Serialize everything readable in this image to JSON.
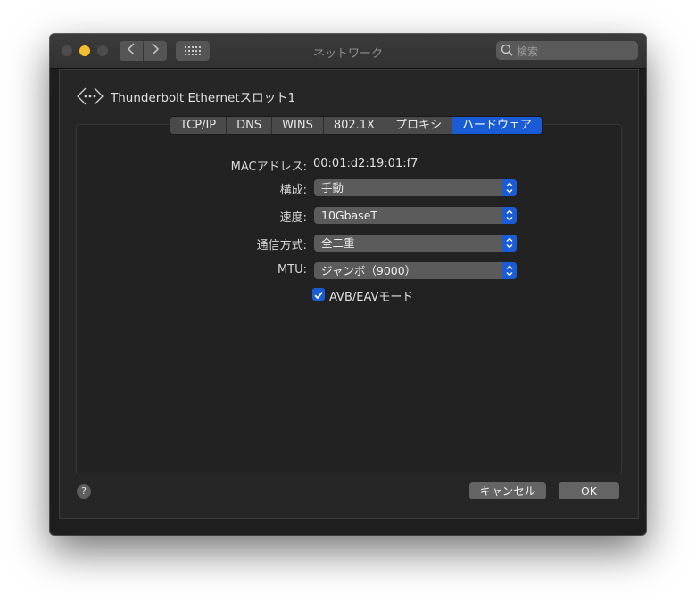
{
  "window": {
    "title": "ネットワーク"
  },
  "search": {
    "placeholder": "検索"
  },
  "interface": {
    "name": "Thunderbolt Ethernetスロット1"
  },
  "tabs": [
    {
      "label": "TCP/IP"
    },
    {
      "label": "DNS"
    },
    {
      "label": "WINS"
    },
    {
      "label": "802.1X"
    },
    {
      "label": "プロキシ"
    },
    {
      "label": "ハードウェア",
      "active": true
    }
  ],
  "hardware": {
    "mac_label": "MACアドレス:",
    "mac_value": "00:01:d2:19:01:f7",
    "config_label": "構成:",
    "config_value": "手動",
    "speed_label": "速度:",
    "speed_value": "10GbaseT",
    "duplex_label": "通信方式:",
    "duplex_value": "全二重",
    "mtu_label": "MTU:",
    "mtu_value": "ジャンボ（9000）",
    "avb_label": "AVB/EAVモード",
    "avb_checked": true
  },
  "footer": {
    "help": "?",
    "cancel_label": "キャンセル",
    "ok_label": "OK"
  },
  "colors": {
    "accent": "#1a5bd6",
    "window_bg": "#1e1e1e"
  }
}
